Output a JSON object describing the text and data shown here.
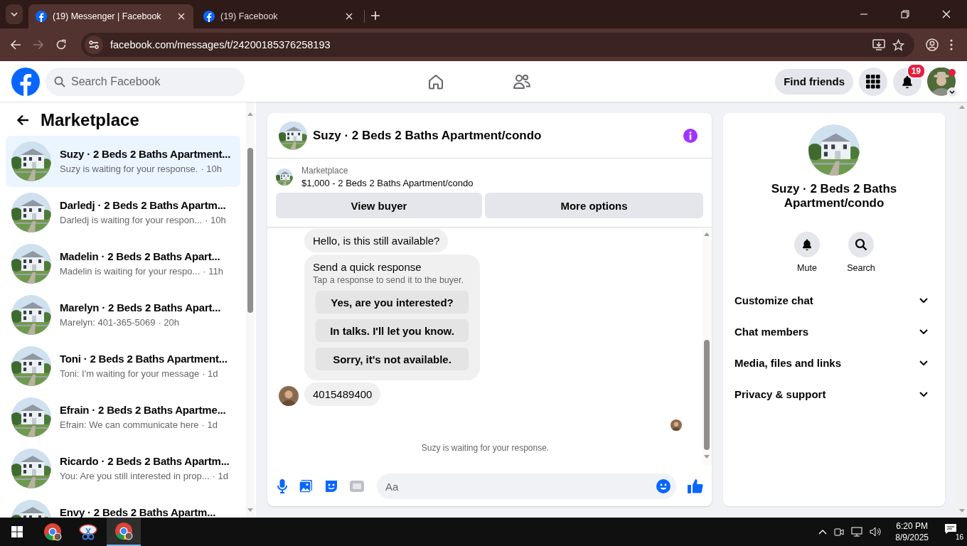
{
  "browser": {
    "tabs": [
      {
        "title": "(19) Messenger | Facebook",
        "selected": true
      },
      {
        "title": "(19) Facebook",
        "selected": false
      }
    ],
    "url": "facebook.com/messages/t/24200185376258193"
  },
  "header": {
    "search_placeholder": "Search Facebook",
    "find_friends": "Find friends",
    "notification_count": "19"
  },
  "sidebar": {
    "title": "Marketplace",
    "conversations": [
      {
        "name": "Suzy · 2 Beds 2 Baths Apartment...",
        "snippet": "Suzy is waiting for your response.",
        "time": "· 10h",
        "selected": true
      },
      {
        "name": "Darledj · 2 Beds 2 Baths Apartm...",
        "snippet": "Darledj is waiting for your respon...",
        "time": "· 10h",
        "selected": false
      },
      {
        "name": "Madelin · 2 Beds 2 Baths Apart...",
        "snippet": "Madelin is waiting for your respo...",
        "time": "· 11h",
        "selected": false
      },
      {
        "name": "Marelyn · 2 Beds 2 Baths Apart...",
        "snippet": "Marelyn: 401-365-5069",
        "time": "· 20h",
        "selected": false
      },
      {
        "name": "Toni · 2 Beds 2 Baths Apartment...",
        "snippet": "Toni: I'm waiting for your message",
        "time": "· 1d",
        "selected": false
      },
      {
        "name": "Efrain · 2 Beds 2 Baths Apartme...",
        "snippet": "Efrain: We can communicate here",
        "time": "· 1d",
        "selected": false
      },
      {
        "name": "Ricardo · 2 Beds 2 Baths Apartm...",
        "snippet": "You: Are you still interested in prop...",
        "time": "· 1d",
        "selected": false
      },
      {
        "name": "Envy · 2 Beds 2 Baths Apartm...",
        "selected": false
      }
    ]
  },
  "chat": {
    "title": "Suzy · 2 Beds 2 Baths Apartment/condo",
    "listing": {
      "label": "Marketplace",
      "title": "$1,000 - 2 Beds 2 Baths Apartment/condo"
    },
    "buttons": [
      "View buyer",
      "More options"
    ],
    "messages": [
      {
        "kind": "text",
        "text": "Hello, is this still available?",
        "avatar": false
      },
      {
        "kind": "quick_response",
        "title": "Send a quick response",
        "subtitle": "Tap a response to send it to the buyer.",
        "options": [
          "Yes, are you interested?",
          "In talks. I'll let you know.",
          "Sorry, it's not available."
        ]
      },
      {
        "kind": "text",
        "text": "4015489400",
        "avatar": true
      }
    ],
    "status": "Suzy is waiting for your response.",
    "composer": {
      "placeholder": "Aa"
    }
  },
  "info": {
    "title": "Suzy · 2 Beds 2 Baths Apartment/condo",
    "actions": [
      {
        "kind": "mute",
        "label": "Mute"
      },
      {
        "kind": "search",
        "label": "Search"
      }
    ],
    "sections": [
      "Customize chat",
      "Chat members",
      "Media, files and links",
      "Privacy & support"
    ]
  },
  "taskbar": {
    "apps": [
      {
        "kind": "chrome",
        "selected": false
      },
      {
        "kind": "snipping",
        "selected": false
      },
      {
        "kind": "chrome",
        "selected": true
      }
    ],
    "time": "6:20 PM",
    "date": "8/9/2025",
    "notification_count": "16"
  }
}
